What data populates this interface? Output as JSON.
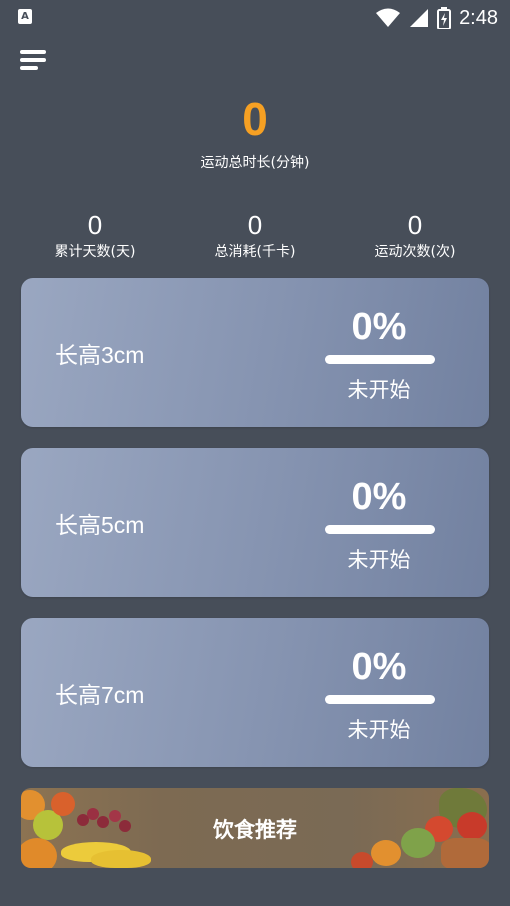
{
  "status_bar": {
    "app_icon_letter": "A",
    "time": "2:48",
    "icons": [
      "wifi-icon",
      "signal-icon",
      "battery-icon"
    ]
  },
  "header": {
    "menu_icon": "menu-icon"
  },
  "summary": {
    "total_minutes": "0",
    "total_minutes_label": "运动总时长(分钟)",
    "accent_color": "#f6a023",
    "stats": [
      {
        "value": "0",
        "label": "累计天数(天)"
      },
      {
        "value": "0",
        "label": "总消耗(千卡)"
      },
      {
        "value": "0",
        "label": "运动次数(次)"
      }
    ]
  },
  "plans": [
    {
      "title": "长高3cm",
      "percent": "0%",
      "progress": 0,
      "status": "未开始"
    },
    {
      "title": "长高5cm",
      "percent": "0%",
      "progress": 0,
      "status": "未开始"
    },
    {
      "title": "长高7cm",
      "percent": "0%",
      "progress": 0,
      "status": "未开始"
    }
  ],
  "diet_banner": {
    "label": "饮食推荐"
  }
}
